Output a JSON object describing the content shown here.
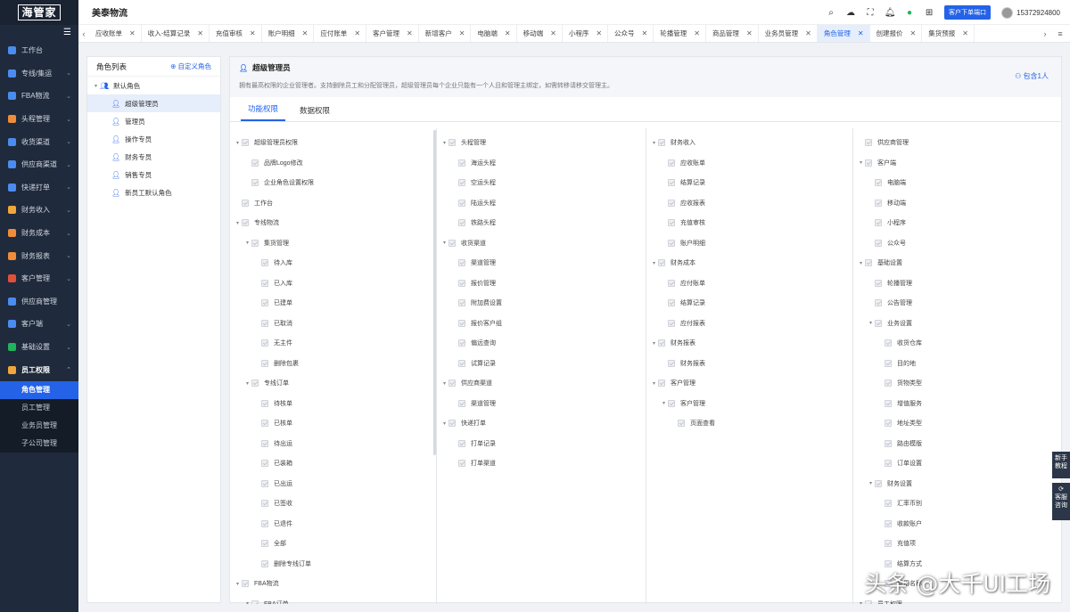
{
  "brand": {
    "logo": "海管家"
  },
  "sidebar": {
    "items": [
      {
        "label": "工作台",
        "color": "#4a8cf0",
        "open": false,
        "arrow": ""
      },
      {
        "label": "专线/集运",
        "color": "#4a8cf0",
        "open": false,
        "arrow": "⌄"
      },
      {
        "label": "FBA物流",
        "color": "#4a8cf0",
        "open": false,
        "arrow": "⌄"
      },
      {
        "label": "头程管理",
        "color": "#f08c3a",
        "open": false,
        "arrow": "⌄"
      },
      {
        "label": "收货渠道",
        "color": "#4a8cf0",
        "open": false,
        "arrow": "⌄"
      },
      {
        "label": "供应商渠道",
        "color": "#4a8cf0",
        "open": false,
        "arrow": "⌄"
      },
      {
        "label": "快递打单",
        "color": "#4a8cf0",
        "open": false,
        "arrow": "⌄"
      },
      {
        "label": "财务收入",
        "color": "#f0a63a",
        "open": false,
        "arrow": "⌄"
      },
      {
        "label": "财务成本",
        "color": "#f08c3a",
        "open": false,
        "arrow": "⌄"
      },
      {
        "label": "财务报表",
        "color": "#f08c3a",
        "open": false,
        "arrow": "⌄"
      },
      {
        "label": "客户管理",
        "color": "#e2503a",
        "open": false,
        "arrow": "⌄"
      },
      {
        "label": "供应商管理",
        "color": "#4a8cf0",
        "open": false,
        "arrow": ""
      },
      {
        "label": "客户端",
        "color": "#4a8cf0",
        "open": false,
        "arrow": "⌄"
      },
      {
        "label": "基础设置",
        "color": "#21b35c",
        "open": false,
        "arrow": "⌄"
      },
      {
        "label": "员工权限",
        "color": "#f0a63a",
        "open": true,
        "arrow": "⌃"
      }
    ],
    "sub_items": [
      {
        "label": "角色管理",
        "active": true
      },
      {
        "label": "员工管理",
        "active": false
      },
      {
        "label": "业务员管理",
        "active": false
      },
      {
        "label": "子公司管理",
        "active": false
      }
    ]
  },
  "header": {
    "company": "美泰物流",
    "portal_button": "客户下单端口",
    "phone": "15372924800",
    "icons": [
      "search-icon",
      "cloud-download-icon",
      "fullscreen-icon",
      "bell-icon",
      "wechat-icon",
      "grid-icon"
    ]
  },
  "tabs": [
    {
      "label": "应收账单",
      "active": false
    },
    {
      "label": "收入-结算记录",
      "active": false
    },
    {
      "label": "充值审核",
      "active": false
    },
    {
      "label": "账户明细",
      "active": false
    },
    {
      "label": "应付账单",
      "active": false
    },
    {
      "label": "客户管理",
      "active": false
    },
    {
      "label": "新增客户",
      "active": false
    },
    {
      "label": "电脑端",
      "active": false
    },
    {
      "label": "移动端",
      "active": false
    },
    {
      "label": "小程序",
      "active": false
    },
    {
      "label": "公众号",
      "active": false
    },
    {
      "label": "轮播管理",
      "active": false
    },
    {
      "label": "商品管理",
      "active": false
    },
    {
      "label": "业务员管理",
      "active": false
    },
    {
      "label": "角色管理",
      "active": true
    },
    {
      "label": "创建报价",
      "active": false
    },
    {
      "label": "集货预报",
      "active": false
    }
  ],
  "roles": {
    "title": "角色列表",
    "add_label": "自定义角色",
    "root": "默认角色",
    "items": [
      {
        "label": "超级管理员",
        "active": true
      },
      {
        "label": "管理员",
        "active": false
      },
      {
        "label": "操作专员",
        "active": false
      },
      {
        "label": "财务专员",
        "active": false
      },
      {
        "label": "销售专员",
        "active": false
      },
      {
        "label": "新员工默认角色",
        "active": false
      }
    ]
  },
  "detail": {
    "title": "超级管理员",
    "description": "拥有最高权限的企业管理者。支持删除员工和分配管理员，超级管理员每个企业只能有一个人且和管理主绑定，如需转移请移交管理主。",
    "member_count": "包含1人",
    "tabs": [
      "功能权限",
      "数据权限"
    ],
    "active_tab": 0
  },
  "permissions": [
    [
      {
        "label": "超级管理员权限",
        "level": 0,
        "caret": true
      },
      {
        "label": "品牌Logo修改",
        "level": 1,
        "caret": false
      },
      {
        "label": "企业角色设置权限",
        "level": 1,
        "caret": false
      },
      {
        "label": "工作台",
        "level": 0,
        "caret": false
      },
      {
        "label": "专线物流",
        "level": 0,
        "caret": true
      },
      {
        "label": "集货管理",
        "level": 1,
        "caret": true
      },
      {
        "label": "待入库",
        "level": 2,
        "caret": false
      },
      {
        "label": "已入库",
        "level": 2,
        "caret": false
      },
      {
        "label": "已建单",
        "level": 2,
        "caret": false
      },
      {
        "label": "已取消",
        "level": 2,
        "caret": false
      },
      {
        "label": "无主件",
        "level": 2,
        "caret": false
      },
      {
        "label": "删除包裹",
        "level": 2,
        "caret": false
      },
      {
        "label": "专线订单",
        "level": 1,
        "caret": true
      },
      {
        "label": "待核单",
        "level": 2,
        "caret": false
      },
      {
        "label": "已核单",
        "level": 2,
        "caret": false
      },
      {
        "label": "待出运",
        "level": 2,
        "caret": false
      },
      {
        "label": "已装箱",
        "level": 2,
        "caret": false
      },
      {
        "label": "已出运",
        "level": 2,
        "caret": false
      },
      {
        "label": "已签收",
        "level": 2,
        "caret": false
      },
      {
        "label": "已退件",
        "level": 2,
        "caret": false
      },
      {
        "label": "全部",
        "level": 2,
        "caret": false
      },
      {
        "label": "删除专线订单",
        "level": 2,
        "caret": false
      },
      {
        "label": "FBA物流",
        "level": 0,
        "caret": true
      },
      {
        "label": "FBA订单",
        "level": 1,
        "caret": true
      }
    ],
    [
      {
        "label": "头程管理",
        "level": 0,
        "caret": true
      },
      {
        "label": "海运头程",
        "level": 1,
        "caret": false
      },
      {
        "label": "空运头程",
        "level": 1,
        "caret": false
      },
      {
        "label": "陆运头程",
        "level": 1,
        "caret": false
      },
      {
        "label": "铁路头程",
        "level": 1,
        "caret": false
      },
      {
        "label": "收货渠道",
        "level": 0,
        "caret": true
      },
      {
        "label": "渠道管理",
        "level": 1,
        "caret": false
      },
      {
        "label": "报价管理",
        "level": 1,
        "caret": false
      },
      {
        "label": "附加费设置",
        "level": 1,
        "caret": false
      },
      {
        "label": "报价客户组",
        "level": 1,
        "caret": false
      },
      {
        "label": "偏远查询",
        "level": 1,
        "caret": false
      },
      {
        "label": "试算记录",
        "level": 1,
        "caret": false
      },
      {
        "label": "供应商渠道",
        "level": 0,
        "caret": true
      },
      {
        "label": "渠道管理",
        "level": 1,
        "caret": false
      },
      {
        "label": "快递打单",
        "level": 0,
        "caret": true
      },
      {
        "label": "打单记录",
        "level": 1,
        "caret": false
      },
      {
        "label": "打单渠道",
        "level": 1,
        "caret": false
      }
    ],
    [
      {
        "label": "财务收入",
        "level": 0,
        "caret": true
      },
      {
        "label": "应收账单",
        "level": 1,
        "caret": false
      },
      {
        "label": "结算记录",
        "level": 1,
        "caret": false
      },
      {
        "label": "应收报表",
        "level": 1,
        "caret": false
      },
      {
        "label": "充值审核",
        "level": 1,
        "caret": false
      },
      {
        "label": "账户明细",
        "level": 1,
        "caret": false
      },
      {
        "label": "财务成本",
        "level": 0,
        "caret": true
      },
      {
        "label": "应付账单",
        "level": 1,
        "caret": false
      },
      {
        "label": "结算记录",
        "level": 1,
        "caret": false
      },
      {
        "label": "应付报表",
        "level": 1,
        "caret": false
      },
      {
        "label": "财务报表",
        "level": 0,
        "caret": true
      },
      {
        "label": "财务报表",
        "level": 1,
        "caret": false
      },
      {
        "label": "客户管理",
        "level": 0,
        "caret": true
      },
      {
        "label": "客户管理",
        "level": 1,
        "caret": true
      },
      {
        "label": "页面查看",
        "level": 2,
        "caret": false
      }
    ],
    [
      {
        "label": "供应商管理",
        "level": 0,
        "caret": false
      },
      {
        "label": "客户端",
        "level": 0,
        "caret": true
      },
      {
        "label": "电脑端",
        "level": 1,
        "caret": false
      },
      {
        "label": "移动端",
        "level": 1,
        "caret": false
      },
      {
        "label": "小程序",
        "level": 1,
        "caret": false
      },
      {
        "label": "公众号",
        "level": 1,
        "caret": false
      },
      {
        "label": "基础设置",
        "level": 0,
        "caret": true
      },
      {
        "label": "轮播管理",
        "level": 1,
        "caret": false
      },
      {
        "label": "公告管理",
        "level": 1,
        "caret": false
      },
      {
        "label": "业务设置",
        "level": 1,
        "caret": true
      },
      {
        "label": "收货仓库",
        "level": 2,
        "caret": false
      },
      {
        "label": "目的地",
        "level": 2,
        "caret": false
      },
      {
        "label": "货物类型",
        "level": 2,
        "caret": false
      },
      {
        "label": "增值服务",
        "level": 2,
        "caret": false
      },
      {
        "label": "地址类型",
        "level": 2,
        "caret": false
      },
      {
        "label": "路由模版",
        "level": 2,
        "caret": false
      },
      {
        "label": "订单设置",
        "level": 2,
        "caret": false
      },
      {
        "label": "财务设置",
        "level": 1,
        "caret": true
      },
      {
        "label": "汇率币别",
        "level": 2,
        "caret": false
      },
      {
        "label": "收款账户",
        "level": 2,
        "caret": false
      },
      {
        "label": "充值项",
        "level": 2,
        "caret": false
      },
      {
        "label": "结算方式",
        "level": 2,
        "caret": false
      },
      {
        "label": "费用名称",
        "level": 2,
        "caret": false
      },
      {
        "label": "员工权限",
        "level": 0,
        "caret": true
      }
    ]
  ],
  "floating": {
    "guide": "新手教程",
    "service": "客服咨询"
  },
  "watermark": "头条 @大千UI工场"
}
